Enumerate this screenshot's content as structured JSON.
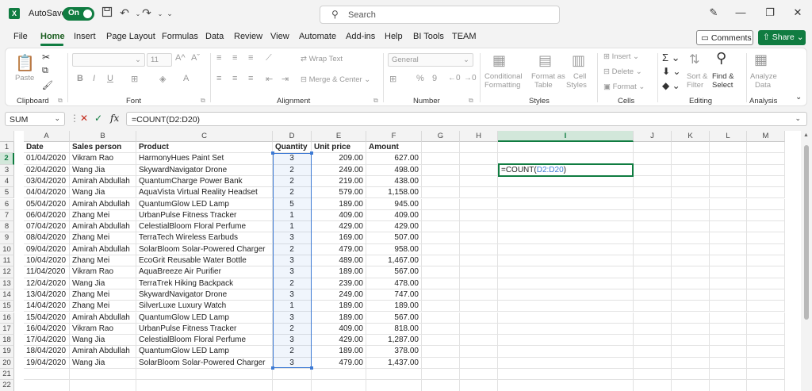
{
  "titlebar": {
    "logo": "X",
    "autosave_label": "AutoSave",
    "toggle_text": "On",
    "search_placeholder": "Search",
    "icons": [
      "save-icon",
      "undo-icon",
      "redo-icon",
      "customize-icon",
      "pen-icon",
      "minimize-icon",
      "restore-icon",
      "close-icon"
    ]
  },
  "menu": {
    "items": [
      "File",
      "Home",
      "Insert",
      "Page Layout",
      "Formulas",
      "Data",
      "Review",
      "View",
      "Automate",
      "Add-ins",
      "Help",
      "BI Tools",
      "TEAM"
    ],
    "active": "Home",
    "comments_label": "Comments",
    "share_label": "Share"
  },
  "ribbon": {
    "groups": [
      "Clipboard",
      "Font",
      "Alignment",
      "Number",
      "Styles",
      "Cells",
      "Editing",
      "Analysis"
    ],
    "paste": "Paste",
    "font_size": "11",
    "wrap_text": "Wrap Text",
    "merge_center": "Merge & Center",
    "number_format": "General",
    "conditional": "Conditional",
    "formatting": "Formatting",
    "format_as": "Format as",
    "table": "Table",
    "cell": "Cell",
    "styles": "Styles",
    "insert": "Insert",
    "delete": "Delete",
    "format": "Format",
    "sort": "Sort &",
    "filter": "Filter",
    "find": "Find &",
    "select": "Select",
    "analyze": "Analyze",
    "data": "Data"
  },
  "formula_bar": {
    "name_box": "SUM",
    "formula": "=COUNT(D2:D20)"
  },
  "columns": [
    "A",
    "B",
    "C",
    "D",
    "E",
    "F",
    "G",
    "H",
    "I",
    "J",
    "K",
    "L",
    "M"
  ],
  "rows": [
    "1",
    "2",
    "3",
    "4",
    "5",
    "6",
    "7",
    "8",
    "9",
    "10",
    "11",
    "12",
    "13",
    "14",
    "15",
    "16",
    "17",
    "18",
    "19",
    "20",
    "21",
    "22"
  ],
  "table": {
    "headers": [
      "Date",
      "Sales person",
      "Product",
      "Quantity",
      "Unit price",
      "Amount"
    ],
    "rows": [
      [
        "01/04/2020",
        "Vikram Rao",
        "HarmonyHues Paint Set",
        "3",
        "209.00",
        "627.00"
      ],
      [
        "02/04/2020",
        "Wang Jia",
        "SkywardNavigator Drone",
        "2",
        "249.00",
        "498.00"
      ],
      [
        "03/04/2020",
        "Amirah Abdullah",
        "QuantumCharge Power Bank",
        "2",
        "219.00",
        "438.00"
      ],
      [
        "04/04/2020",
        "Wang Jia",
        "AquaVista Virtual Reality Headset",
        "2",
        "579.00",
        "1,158.00"
      ],
      [
        "05/04/2020",
        "Amirah Abdullah",
        "QuantumGlow LED Lamp",
        "5",
        "189.00",
        "945.00"
      ],
      [
        "06/04/2020",
        "Zhang Mei",
        "UrbanPulse Fitness Tracker",
        "1",
        "409.00",
        "409.00"
      ],
      [
        "07/04/2020",
        "Amirah Abdullah",
        "CelestialBloom Floral Perfume",
        "1",
        "429.00",
        "429.00"
      ],
      [
        "08/04/2020",
        "Zhang Mei",
        "TerraTech Wireless Earbuds",
        "3",
        "169.00",
        "507.00"
      ],
      [
        "09/04/2020",
        "Amirah Abdullah",
        "SolarBloom Solar-Powered Charger",
        "2",
        "479.00",
        "958.00"
      ],
      [
        "10/04/2020",
        "Zhang Mei",
        "EcoGrit Reusable Water Bottle",
        "3",
        "489.00",
        "1,467.00"
      ],
      [
        "11/04/2020",
        "Vikram Rao",
        "AquaBreeze Air Purifier",
        "3",
        "189.00",
        "567.00"
      ],
      [
        "12/04/2020",
        "Wang Jia",
        "TerraTrek Hiking Backpack",
        "2",
        "239.00",
        "478.00"
      ],
      [
        "13/04/2020",
        "Zhang Mei",
        "SkywardNavigator Drone",
        "3",
        "249.00",
        "747.00"
      ],
      [
        "14/04/2020",
        "Zhang Mei",
        "SilverLuxe Luxury Watch",
        "1",
        "189.00",
        "189.00"
      ],
      [
        "15/04/2020",
        "Amirah Abdullah",
        "QuantumGlow LED Lamp",
        "3",
        "189.00",
        "567.00"
      ],
      [
        "16/04/2020",
        "Vikram Rao",
        "UrbanPulse Fitness Tracker",
        "2",
        "409.00",
        "818.00"
      ],
      [
        "17/04/2020",
        "Wang Jia",
        "CelestialBloom Floral Perfume",
        "3",
        "429.00",
        "1,287.00"
      ],
      [
        "18/04/2020",
        "Amirah Abdullah",
        "QuantumGlow LED Lamp",
        "2",
        "189.00",
        "378.00"
      ],
      [
        "19/04/2020",
        "Wang Jia",
        "SolarBloom Solar-Powered Charger",
        "3",
        "479.00",
        "1,437.00"
      ]
    ]
  },
  "active_cell": {
    "prefix": "=COUNT(",
    "ref": "D2:D20",
    "suffix": ")"
  },
  "colors": {
    "accent": "#107c41",
    "selection": "#3d7ad4"
  }
}
